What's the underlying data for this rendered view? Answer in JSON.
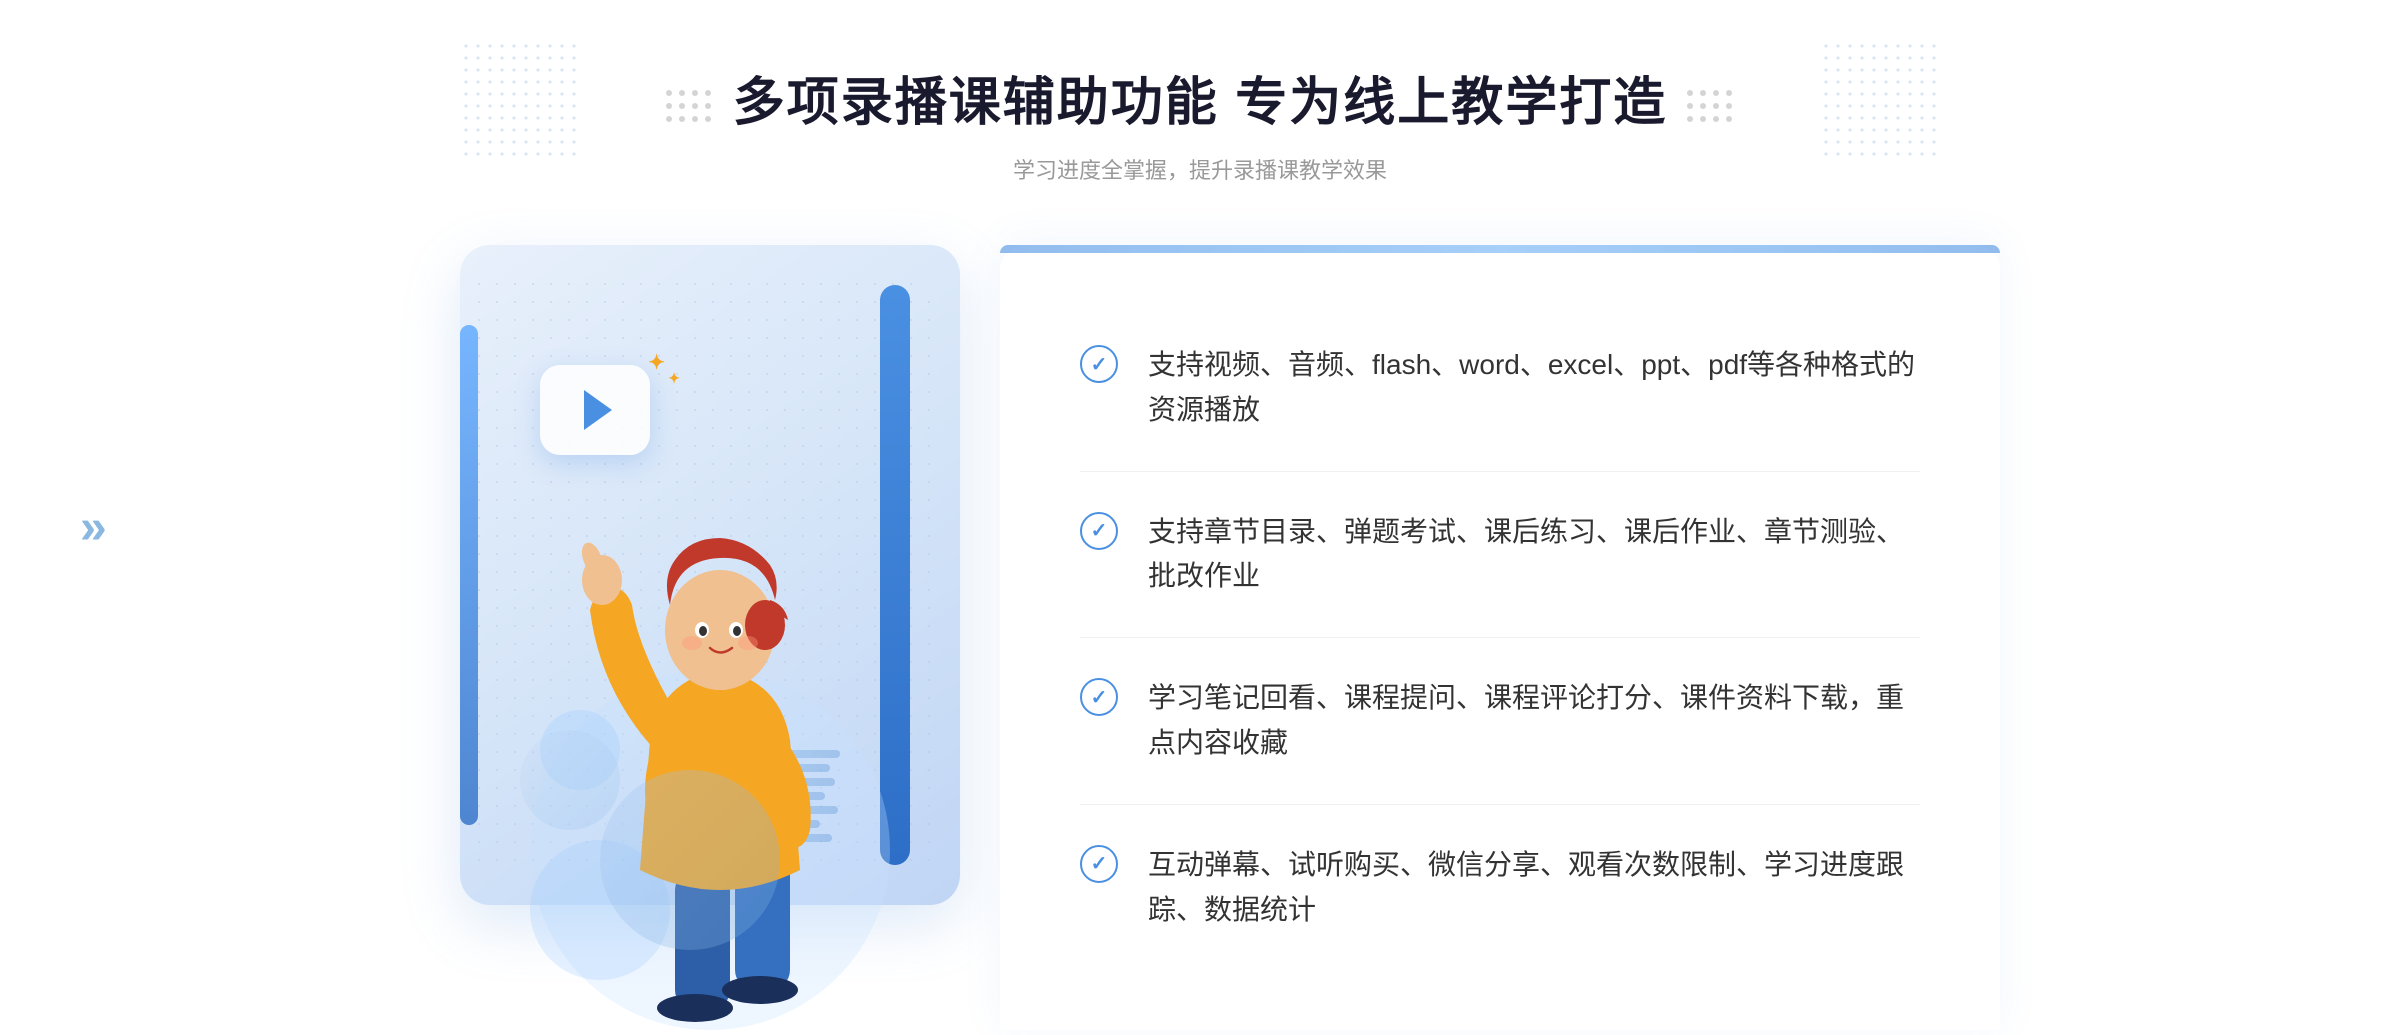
{
  "header": {
    "main_title": "多项录播课辅助功能 专为线上教学打造",
    "sub_title": "学习进度全掌握，提升录播课教学效果"
  },
  "features": [
    {
      "id": 1,
      "text": "支持视频、音频、flash、word、excel、ppt、pdf等各种格式的资源播放"
    },
    {
      "id": 2,
      "text": "支持章节目录、弹题考试、课后练习、课后作业、章节测验、批改作业"
    },
    {
      "id": 3,
      "text": "学习笔记回看、课程提问、课程评论打分、课件资料下载，重点内容收藏"
    },
    {
      "id": 4,
      "text": "互动弹幕、试听购买、微信分享、观看次数限制、学习进度跟踪、数据统计"
    }
  ],
  "icons": {
    "check": "✓",
    "play": "▶",
    "chevron": "»",
    "sparkle": "✦"
  },
  "colors": {
    "primary_blue": "#4a90e2",
    "dark_blue": "#2d6ec7",
    "light_blue_bg": "#e8f0fb",
    "text_dark": "#333333",
    "text_gray": "#999999",
    "title_dark": "#1a1a2e"
  }
}
